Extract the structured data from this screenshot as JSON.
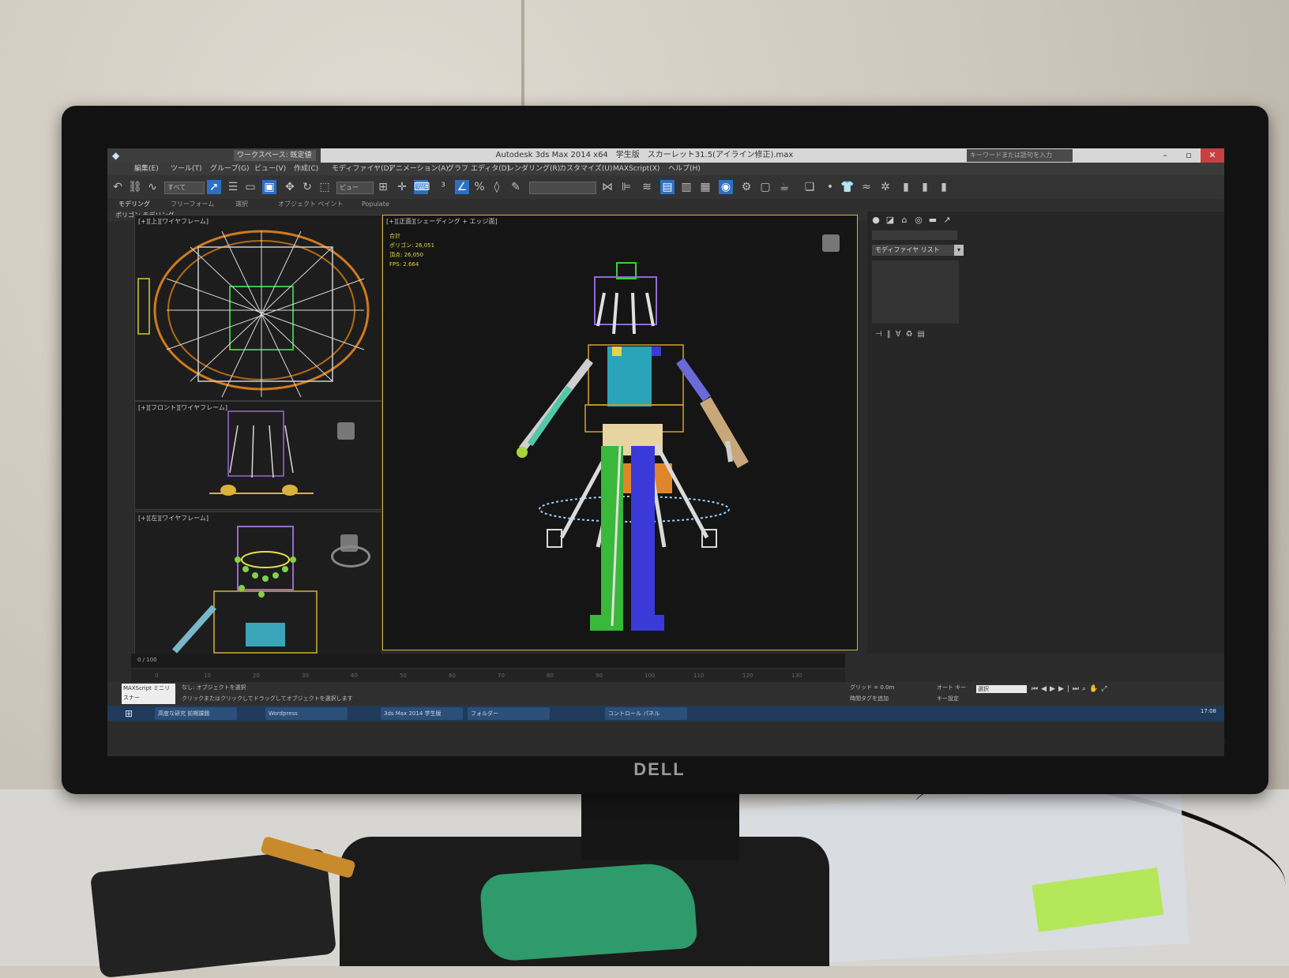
{
  "window": {
    "title": "Autodesk 3ds Max 2014 x64　学生版　スカーレット31.5(アイライン修正).max",
    "workspace": "ワークスペース: 既定値",
    "help_search": "キーワードまたは語句を入力"
  },
  "menu": [
    {
      "label": "編集(E)"
    },
    {
      "label": "ツール(T)"
    },
    {
      "label": "グループ(G)"
    },
    {
      "label": "ビュー(V)"
    },
    {
      "label": "作成(C)"
    },
    {
      "label": "モディファイヤ(D)"
    },
    {
      "label": "アニメーション(A)"
    },
    {
      "label": "グラフ エディタ(D)"
    },
    {
      "label": "レンダリング(R)"
    },
    {
      "label": "カスタマイズ(U)"
    },
    {
      "label": "MAXScript(X)"
    },
    {
      "label": "ヘルプ(H)"
    }
  ],
  "toolbar": {
    "selection_filter": "すべて",
    "reference_coord": "ビュー"
  },
  "ribbon": {
    "tabs": [
      {
        "label": "モデリング"
      },
      {
        "label": "フリーフォーム"
      },
      {
        "label": "選択"
      },
      {
        "label": "オブジェクト ペイント"
      },
      {
        "label": "Populate"
      }
    ],
    "subtitle": "ポリゴン モデリング"
  },
  "viewports": {
    "top_left_label": "[+][上][ワイヤフレーム]",
    "middle_left_label": "[+][フロント][ワイヤフレーム]",
    "bottom_left_label": "[+][左][ワイヤフレーム]",
    "main_label": "[+][正面][シェーディング + エッジ面]",
    "stats": {
      "total": "合計",
      "polygons": "ポリゴン: 26,051",
      "vertices": "頂点: 26,050",
      "fps": "FPS: 2.664"
    }
  },
  "command_panel": {
    "modifier_list": "モディファイヤ リスト"
  },
  "status": {
    "selected": "なし: オブジェクトを選択",
    "prompt": "クリックまたはクリックしてドラッグしてオブジェクトを選択します",
    "maxscript": "MAXScript ミニリスナー",
    "grid": "グリッド = 0.0m",
    "auto_key": "オート キー",
    "set_key": "キー設定",
    "key_filter": "選択",
    "time_tag": "時間タグを追加"
  },
  "timeline": {
    "frame": "0 / 100",
    "ticks": [
      "0",
      "10",
      "20",
      "30",
      "40",
      "50",
      "60",
      "70",
      "80",
      "90",
      "100",
      "110",
      "120",
      "130"
    ]
  },
  "taskbar": {
    "tasks": [
      {
        "label": "高度な研究 前期課題"
      },
      {
        "label": "Wordpress"
      },
      {
        "label": "3ds Max 2014 学生版"
      },
      {
        "label": "フォルダー"
      },
      {
        "label": "コントロール パネル"
      }
    ],
    "clock": "17:08"
  },
  "monitor": {
    "brand": "DELL"
  },
  "colors": {
    "ui_dark": "#2b2b2b",
    "selection_blue": "#2d6fc3",
    "close_red": "#c94040",
    "active_viewport": "#d8b23a",
    "stats_yellow": "#e2d247",
    "taskbar": "#1f3a5a"
  }
}
